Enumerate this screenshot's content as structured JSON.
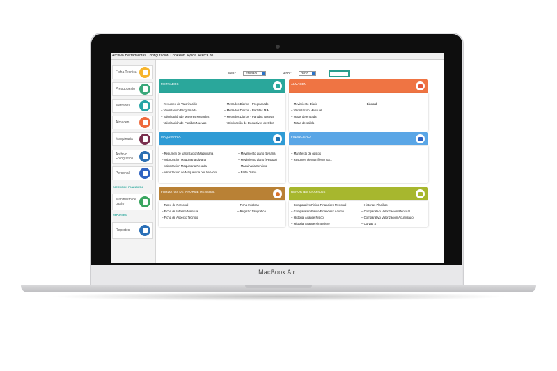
{
  "laptop": {
    "brand": "MacBook Air"
  },
  "menu": [
    "Archivo",
    "Herramientas",
    "Configuración",
    "Conexion",
    "Ayuda",
    "Acerca de"
  ],
  "sidebar": {
    "items": [
      {
        "label": "Ficha Tecnica",
        "color": "#f7b52c",
        "icon": "document-icon"
      },
      {
        "label": "Presupuesto",
        "color": "#3aa87a",
        "icon": "calculator-icon"
      },
      {
        "label": "Metrados",
        "color": "#27a4a6",
        "icon": "ruler-icon"
      },
      {
        "label": "Almacen",
        "color": "#ef6a3c",
        "icon": "warehouse-icon"
      },
      {
        "label": "Maquinaria",
        "color": "#7a2f4e",
        "icon": "tractor-icon"
      },
      {
        "label": "Archivo Fotografico",
        "color": "#2b6fb3",
        "icon": "camera-icon"
      },
      {
        "label": "Personal",
        "color": "#2f63c2",
        "icon": "person-icon"
      }
    ],
    "section_exec": "EJECUCION FINANCIERA",
    "manifiesto": {
      "label": "Manifiesto de gasto",
      "color": "#3aa660",
      "icon": "receipt-icon"
    },
    "section_reports": "REPORTES",
    "reportes": {
      "label": "Reportes",
      "color": "#2a6fb7",
      "icon": "report-icon"
    }
  },
  "controls": {
    "mes_label": "Mes :",
    "mes_value": "ENERO",
    "anio_label": "Año :",
    "anio_value": "2020"
  },
  "panels": {
    "metrados": {
      "title": "METRADOS",
      "color": "#2aa79b",
      "icon_color": "#2aa79b",
      "col1": [
        "Resumen de Valorización",
        "Valorización Programada",
        "Valorización de Mayores Metrados",
        "Valorización de Partidas Nuevas"
      ],
      "col2": [
        "Metrados Diarios - Programado",
        "Metrados Diarios - Partidas M.M.",
        "Metrados Diarios - Partidas Nuevas",
        "Valorización de Deductivos de Obra"
      ]
    },
    "almacen": {
      "title": "ALMACEN",
      "color": "#ef7443",
      "icon_color": "#e4573a",
      "col1": [
        "Movimiento Diario",
        "Valorización Mensual",
        "Notas de entrada",
        "Notas de salida"
      ],
      "col2": [
        "Bincard"
      ]
    },
    "maquinaria": {
      "title": "MAQUINARIA",
      "color": "#2f9bd5",
      "icon_color": "#1f6fae",
      "col1": [
        "Resumen de valorizacion Maquinaria",
        "Valorización Maquinaria Liviana",
        "Valorización Maquinaria Pesada",
        "Valorización de Maquinaria por Servicio"
      ],
      "col2": [
        "Movimiento diario (Liviana)",
        "Movimiento diario (Pesada)",
        "Maquinaria Servicio",
        "Parte Diario"
      ]
    },
    "financiero": {
      "title": "FINANCIERO",
      "color": "#5aa6e6",
      "icon_color": "#2f63c2",
      "col1": [
        "Manifiesto de gastos",
        "Resumen de Manifiesto Ga..."
      ],
      "col2": []
    },
    "formatos": {
      "title": "FORMATOS DE INFORME MENSUAL",
      "color": "#b98135",
      "icon_color": "#d9722b",
      "col1": [
        "Tareo de Personal",
        "Ficha de Informe Mensual",
        "Ficha de Aspecto Tecnico"
      ],
      "col2": [
        "Ficha Infobras",
        "Registro fotografico"
      ]
    },
    "graficos": {
      "title": "REPORTES GRAFICOS",
      "color": "#a7b72e",
      "icon_color": "#a7b72e",
      "col1": [
        "Comparativo Fisico-Financiero Mensual",
        "Comparativo Fisico-Financiero Acumu...",
        "Historial Avance Fisico",
        "Historial Avance Financiero"
      ],
      "col2": [
        "Historias Planillas",
        "Comparativo Valorizacion Mensual",
        "Comparativo Valorizacion Acumulado",
        "Curvas S"
      ]
    }
  }
}
